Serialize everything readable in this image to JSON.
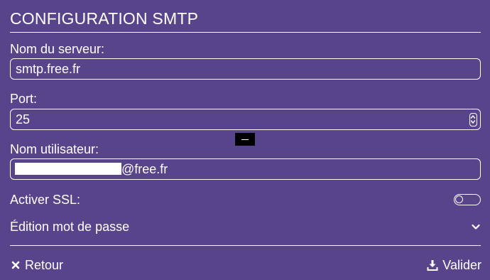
{
  "header": {
    "title": "CONFIGURATION SMTP"
  },
  "server": {
    "label": "Nom du serveur:",
    "value": "smtp.free.fr"
  },
  "port": {
    "label": "Port:",
    "value": "25"
  },
  "username": {
    "label": "Nom utilisateur:",
    "value_suffix": "@free.fr"
  },
  "ssl": {
    "label": "Activer SSL:",
    "enabled": false
  },
  "password": {
    "label": "Édition mot de passe"
  },
  "footer": {
    "back_label": "Retour",
    "validate_label": "Valider"
  },
  "colors": {
    "background": "#57448a",
    "foreground": "#ffffff"
  },
  "icons": {
    "back": "close-x-icon",
    "validate": "download-icon",
    "expand": "chevron-down-icon",
    "stepper": "number-stepper-icon"
  }
}
